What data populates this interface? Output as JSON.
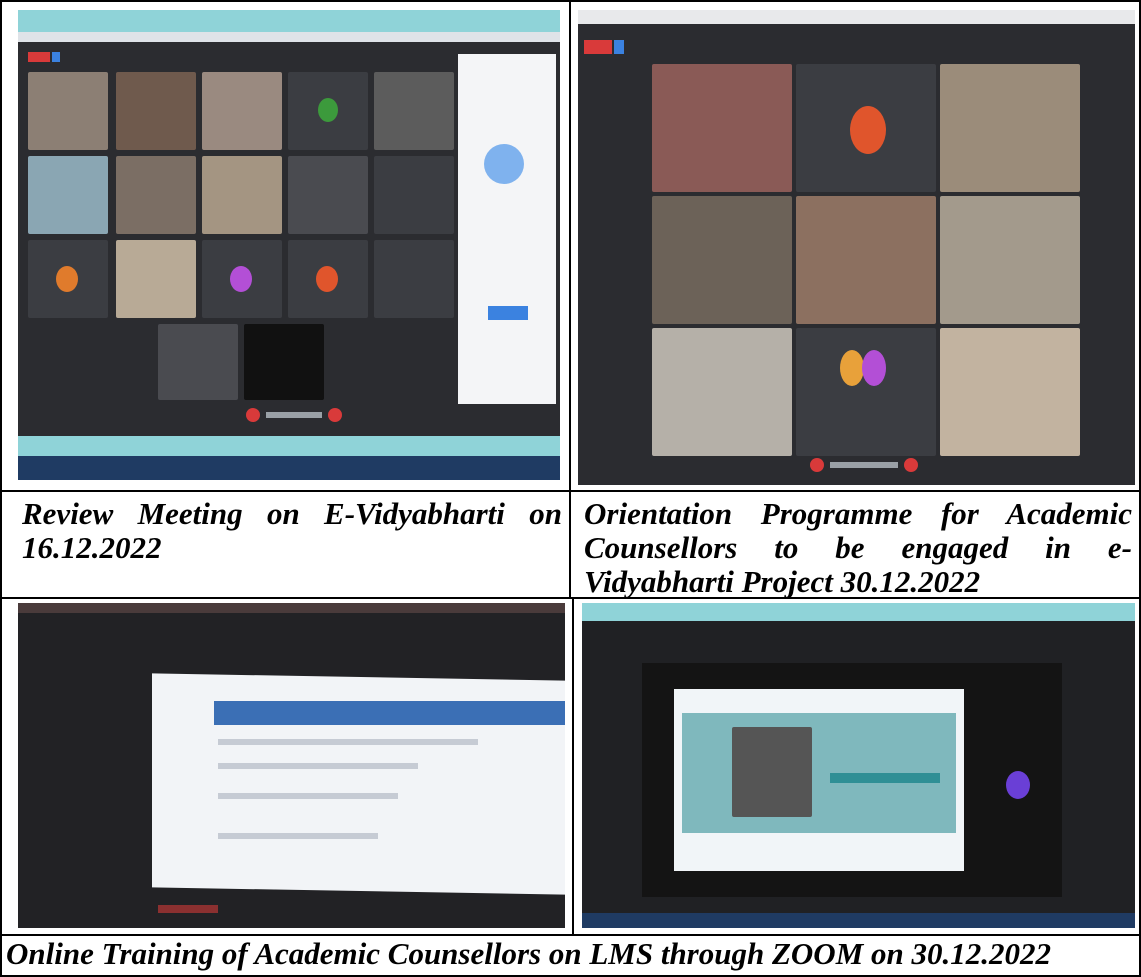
{
  "captions": {
    "top_left": "Review Meeting on E-Vidyabharti on 16.12.2022",
    "top_right": "Orientation Programme for Academic Counsellors to be engaged in e-Vidyabharti Project 30.12.2022",
    "bottom": "Online Training of Academic Counsellors on LMS through ZOOM on 30.12.2022"
  },
  "colors": {
    "meeting_bg": "#2b2c30",
    "tile_dark": "#3b3d42",
    "taskbar": "#1f3b63",
    "browser_bar": "#8fd3d8",
    "end_call_red": "#d93a3a",
    "accent_blue": "#3b82e0"
  }
}
